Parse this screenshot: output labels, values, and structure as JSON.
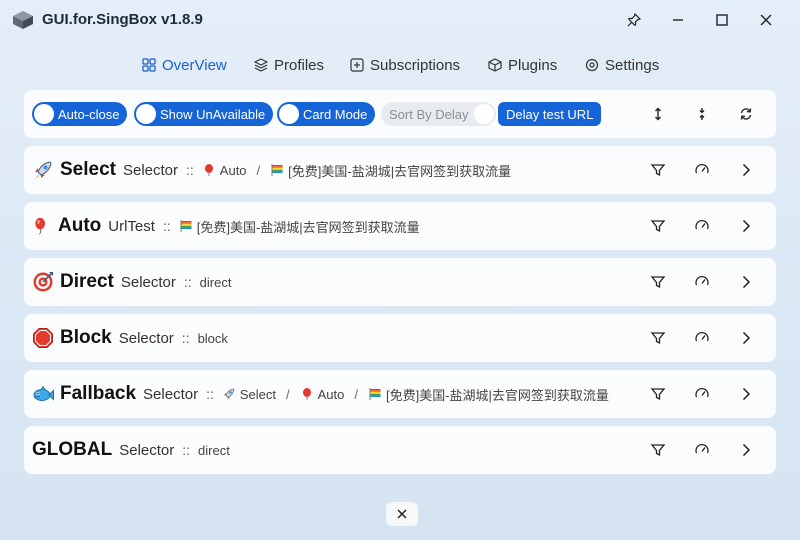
{
  "app": {
    "title": "GUI.for.SingBox v1.8.9"
  },
  "nav": [
    {
      "label": "OverView"
    },
    {
      "label": "Profiles"
    },
    {
      "label": "Subscriptions"
    },
    {
      "label": "Plugins"
    },
    {
      "label": "Settings"
    }
  ],
  "toolbar": {
    "auto_close": "Auto-close",
    "show_unavailable": "Show UnAvailable",
    "card_mode": "Card Mode",
    "sort_by_delay": "Sort By Delay",
    "delay_test_url": "Delay test URL"
  },
  "groups": [
    {
      "name": "Select",
      "type": "Selector",
      "sep": "::",
      "chain": [
        "Auto",
        "[免费]美国-盐湖城|去官网签到获取流量"
      ],
      "slash": "/"
    },
    {
      "name": "Auto",
      "type": "UrlTest",
      "sep": "::",
      "chain": [
        "[免费]美国-盐湖城|去官网签到获取流量"
      ]
    },
    {
      "name": "Direct",
      "type": "Selector",
      "sep": "::",
      "chain": [
        "direct"
      ]
    },
    {
      "name": "Block",
      "type": "Selector",
      "sep": "::",
      "chain": [
        "block"
      ]
    },
    {
      "name": "Fallback",
      "type": "Selector",
      "sep": "::",
      "chain": [
        "Select",
        "Auto",
        "[免费]美国-盐湖城|去官网签到获取流量"
      ],
      "slash": "/"
    },
    {
      "name": "GLOBAL",
      "type": "Selector",
      "sep": "::",
      "chain": [
        "direct"
      ]
    }
  ],
  "colors": {
    "accent": "#1565d8",
    "card": "#fbfcfd"
  }
}
